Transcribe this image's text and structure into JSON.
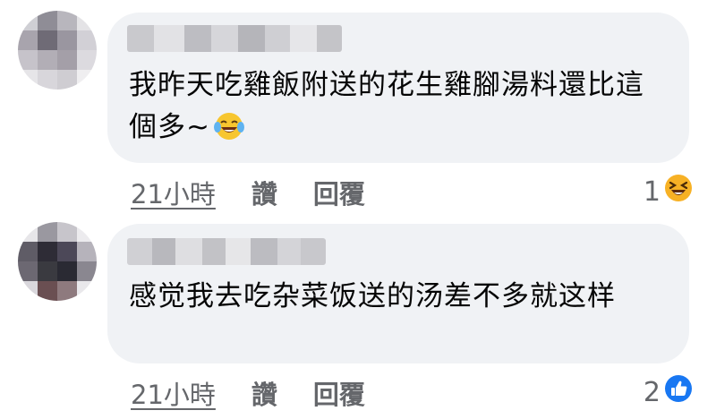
{
  "comments": [
    {
      "text": "我昨天吃雞飯附送的花生雞腳湯料還比這個多~",
      "time": "21小時",
      "like_label": "讚",
      "reply_label": "回覆",
      "reaction_count": "1",
      "reaction_icon": "laughing-emoji-icon",
      "inline_emoji": "tears-of-joy-emoji-icon"
    },
    {
      "text": "感觉我去吃杂菜饭送的汤差不多就这样",
      "time": "21小時",
      "like_label": "讚",
      "reply_label": "回覆",
      "reaction_count": "2",
      "reaction_icon": "thumbs-up-icon"
    }
  ],
  "colors": {
    "bubble": "#f0f2f5",
    "text": "#050505",
    "meta": "#65676b",
    "like_blue": "#1877f2",
    "emoji_yellow": "#f7b125"
  }
}
